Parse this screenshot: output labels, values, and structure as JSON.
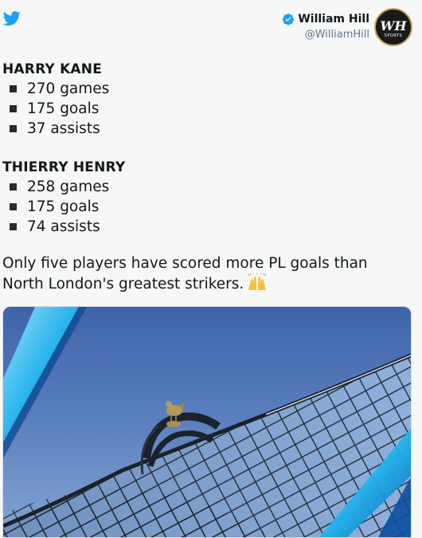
{
  "author": {
    "display_name": "William Hill",
    "handle": "@WilliamHill",
    "verified": true,
    "avatar_logo": "WH",
    "avatar_sub": "SPORTS"
  },
  "icons": {
    "platform": "twitter-bird-icon",
    "verified": "verified-badge-icon",
    "emoji": "raising-hands-emoji"
  },
  "colors": {
    "twitter_blue": "#1da1f2",
    "verified_blue": "#1da1f2",
    "handle_gray": "#657786",
    "avatar_gold": "#c9a75a"
  },
  "tweet": {
    "sections": [
      {
        "title": "HARRY KANE",
        "stats": [
          "270 games",
          "175 goals",
          "37 assists"
        ]
      },
      {
        "title": "THIERRY HENRY",
        "stats": [
          "258 games",
          "175 goals",
          "74 assists"
        ]
      }
    ],
    "body": "Only five players have scored more PL goals than North London's greatest strikers.",
    "emoji": "🙌"
  },
  "media": {
    "type": "photo",
    "subject": "stadium-roof-with-cockerel-statue"
  }
}
